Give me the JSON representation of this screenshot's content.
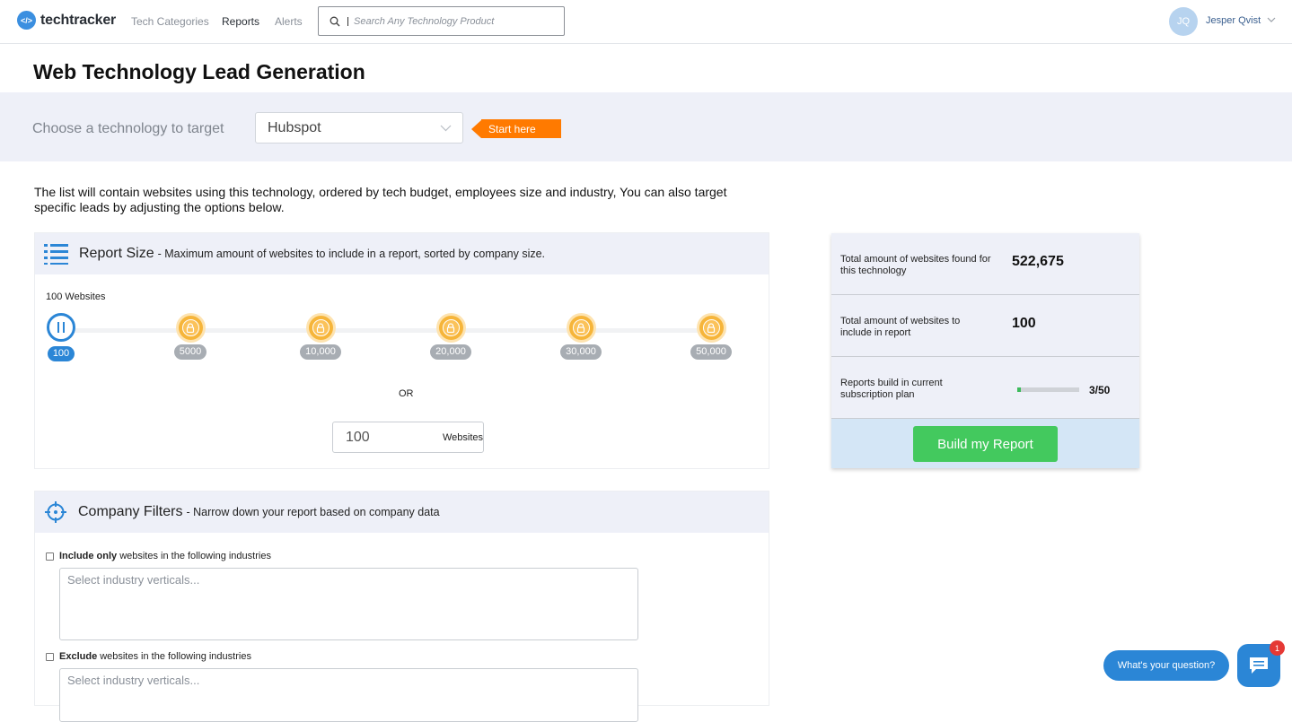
{
  "nav": {
    "logo_mark": "</>",
    "logo_text": "techtracker",
    "links": [
      "Tech Categories",
      "Reports",
      "Alerts"
    ],
    "active_link": "Reports",
    "search_placeholder": "Search Any Technology Product",
    "user_initials": "JQ",
    "user_name": "Jesper Qvist"
  },
  "page": {
    "title": "Web Technology Lead Generation",
    "target_label": "Choose a technology to target",
    "selected_technology": "Hubspot",
    "start_here": "Start here",
    "intro": "The list will contain websites using this technology, ordered by tech budget, employees size and industry, You can also target specific leads by adjusting the options below."
  },
  "report_size": {
    "title": "Report Size",
    "subtitle": "- Maximum amount of websites to include in a report, sorted by company size.",
    "selected_label": "100 Websites",
    "steps": [
      {
        "label": "100",
        "locked": false,
        "active": true
      },
      {
        "label": "5000",
        "locked": true,
        "active": false
      },
      {
        "label": "10,000",
        "locked": true,
        "active": false
      },
      {
        "label": "20,000",
        "locked": true,
        "active": false
      },
      {
        "label": "30,000",
        "locked": true,
        "active": false
      },
      {
        "label": "50,000",
        "locked": true,
        "active": false
      }
    ],
    "or_label": "OR",
    "count_value": "100",
    "count_unit": "Websites"
  },
  "company_filters": {
    "title": "Company Filters",
    "subtitle": "- Narrow down your report based on company data",
    "include_bold": "Include only",
    "include_rest": "websites in the following industries",
    "exclude_bold": "Exclude",
    "exclude_rest": "websites in the following industries",
    "industry_placeholder": "Select industry verticals..."
  },
  "summary": {
    "total_found_label": "Total amount of websites found for this technology",
    "total_found_value": "522,675",
    "include_label": "Total amount of websites to include in report",
    "include_value": "100",
    "reports_label": "Reports build in current subscription plan",
    "reports_value": "3/50",
    "reports_used": 3,
    "reports_total": 50,
    "build_button": "Build my Report"
  },
  "chat": {
    "prompt": "What's your question?",
    "badge": "1"
  },
  "colors": {
    "accent": "#2b86d6",
    "orange": "#ff7a00",
    "green": "#43c95e",
    "band": "#eef0f8"
  }
}
